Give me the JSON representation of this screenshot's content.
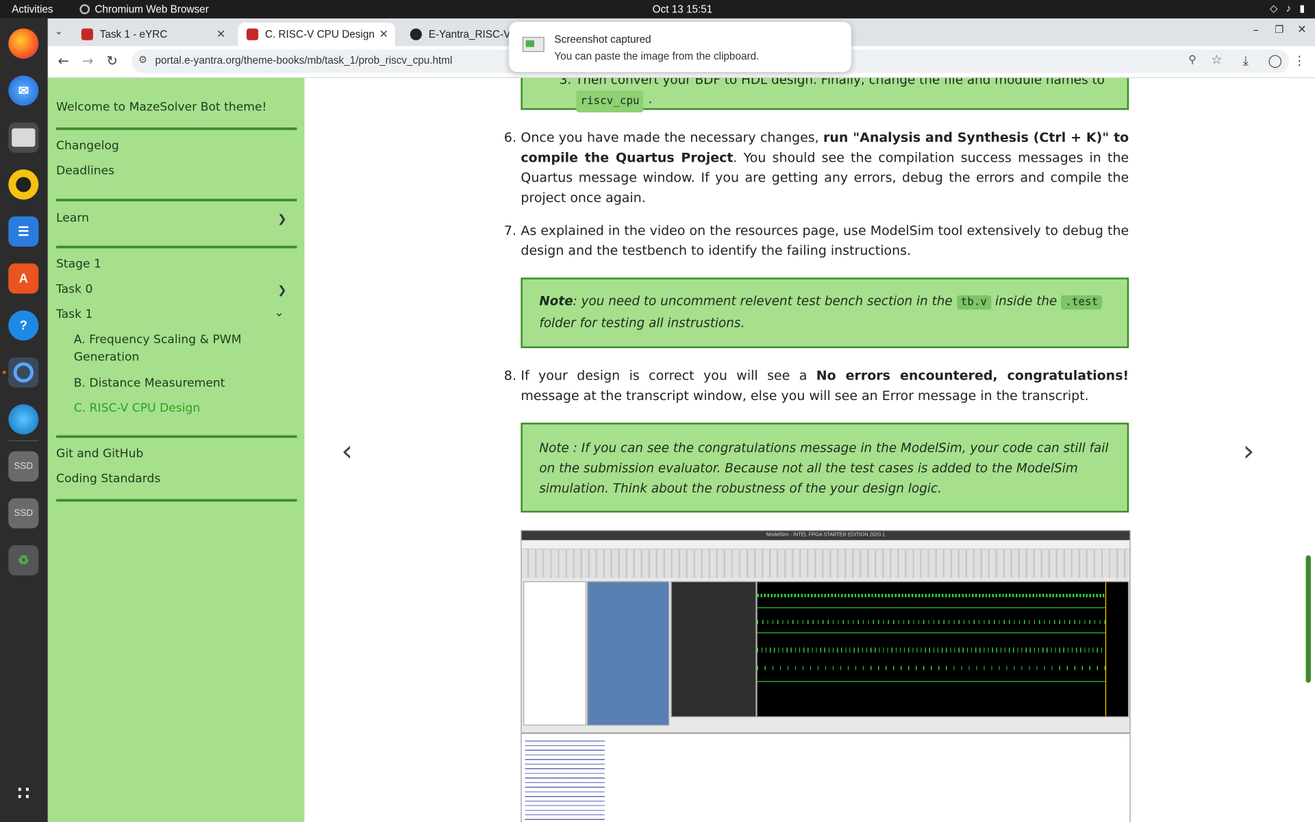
{
  "system": {
    "activities": "Activities",
    "app_name": "Chromium Web Browser",
    "clock": "Oct 13  15:51"
  },
  "browser": {
    "tabs": [
      {
        "title": "Task 1 - eYRC"
      },
      {
        "title": "C. RISC-V CPU Design - M"
      },
      {
        "title": "E-Yantra_RISC-V_C"
      }
    ],
    "url": "portal.e-yantra.org/theme-books/mb/task_1/prob_riscv_cpu.html"
  },
  "notification": {
    "title": "Screenshot captured",
    "body": "You can paste the image from the clipboard."
  },
  "sidebar": {
    "welcome": "Welcome to MazeSolver Bot theme!",
    "changelog": "Changelog",
    "deadlines": "Deadlines",
    "learn": "Learn",
    "stage1": "Stage 1",
    "task0": "Task 0",
    "task1": "Task 1",
    "sub_a": "A. Frequency Scaling & PWM Generation",
    "sub_b": "B. Distance Measurement",
    "sub_c": "C. RISC-V CPU Design",
    "git": "Git and GitHub",
    "coding": "Coding Standards"
  },
  "content": {
    "step5_tail_text": "Then convert your BDF to HDL design. Finally, change the file and module names to",
    "step5_code": "riscv_cpu",
    "step6_num": "6.",
    "step6_a": "Once you have made the necessary changes, ",
    "step6_b": "run \"Analysis and Synthesis (Ctrl + K)\" to compile the Quartus Project",
    "step6_c": ". You should see the compilation success messages in the Quartus message window. If you are getting any errors, debug the errors and compile the project once again.",
    "step7_num": "7.",
    "step7": "As explained in the video on the resources page, use ModelSim tool extensively to debug the design and the testbench to identify the failing instructions.",
    "note1_label": "Note",
    "note1_a": ": you need to uncomment relevent test bench section in the ",
    "note1_code1": "tb.v",
    "note1_b": " inside the ",
    "note1_code2": ".test",
    "note1_c": "folder for testing all instrustions.",
    "step8_num": "8.",
    "step8_a": "If your design is correct you will see a ",
    "step8_b": "No errors encountered, congratulations!",
    "step8_c": " message at the transcript window, else you will see an Error message in the transcript.",
    "note2": "Note : If you can see the congratulations message in the ModelSim, your code can still fail on the submission evaluator. Because not all the test cases is added to the ModelSim simulation. Think about the robustness of the your design logic.",
    "modelsim_title": "ModelSim - INTEL FPGA STARTER EDITION 2020.1"
  }
}
